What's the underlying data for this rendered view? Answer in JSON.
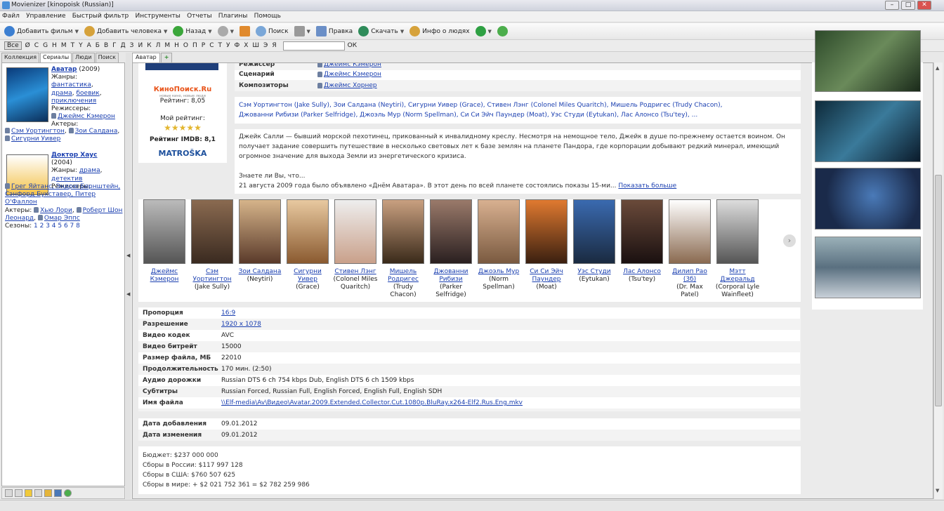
{
  "window": {
    "title": "Movienizer [kinopoisk (Russian)]"
  },
  "menu": [
    "Файл",
    "Управление",
    "Быстрый фильтр",
    "Инструменты",
    "Отчеты",
    "Плагины",
    "Помощь"
  ],
  "toolbar": {
    "add_movie": "Добавить фильм",
    "add_person": "Добавить человека",
    "back": "Назад",
    "search": "Поиск",
    "edit": "Правка",
    "download": "Скачать",
    "people_info": "Инфо о людях"
  },
  "alphabar": {
    "all": "Все",
    "letters": [
      "Ø",
      "C",
      "G",
      "H",
      "M",
      "T",
      "Y",
      "А",
      "Б",
      "В",
      "Г",
      "Д",
      "З",
      "И",
      "К",
      "Л",
      "М",
      "Н",
      "О",
      "П",
      "Р",
      "С",
      "Т",
      "У",
      "Ф",
      "Х",
      "Ш",
      "Э",
      "Я"
    ],
    "ok": "ОК"
  },
  "left_tabs": [
    "Коллекция",
    "Сериалы",
    "Люди",
    "Поиск"
  ],
  "left_movies": [
    {
      "title": "Аватар",
      "year": "(2009)",
      "genre_label": "Жанры:",
      "genres": [
        "фантастика",
        "драма",
        "боевик",
        "приключения"
      ],
      "director_label": "Режиссеры:",
      "director": "Джеймс Кэмерон",
      "actors_label": "Актеры:",
      "actors": [
        "Сэм Уортингтон",
        "Зои Салдана",
        "Сигурни Уивер"
      ]
    },
    {
      "title": "Доктор Хаус",
      "year": "(2004)",
      "genre_label": "Жанры:",
      "genres": [
        "драма",
        "детектив"
      ],
      "director_label": "Режиссеры:",
      "director": "Грег Яйтанс, Эндрю Бернштейн, Сэнфорд Букставер, Питер О'Фаллон",
      "actors_label": "Актеры:",
      "actors": [
        "Хью Лори",
        "Роберт Шон Леонард",
        "Омар Эппс"
      ],
      "seasons_label": "Сезоны:",
      "seasons": "1 2 3 4 5 6 7 8"
    }
  ],
  "right_tabs": [
    "Аватар",
    "+"
  ],
  "ratings": {
    "kp_logo": "КиноПоиск.Ru",
    "kp_sub": "новые кино, новые люди",
    "kp_rating": "Рейтинг: 8,05",
    "my_rating_label": "Мой рейтинг:",
    "stars": "★★★★★",
    "imdb": "Рейтинг IMDB: 8,1",
    "matroska": "MATROŠKA"
  },
  "credits": [
    {
      "label": "Режиссер",
      "value": "Джеймс Кэмерон"
    },
    {
      "label": "Сценарий",
      "value": "Джеймс Кэмерон"
    },
    {
      "label": "Композиторы",
      "value": "Джеймс Хорнер"
    }
  ],
  "cast_line1": "Сэм Уортингтон (Jake Sully), Зои Салдана (Neytiri), Сигурни Уивер (Grace), Стивен Лэнг (Colonel Miles Quaritch), Мишель Родригес (Trudy Chacon),",
  "cast_line2": "Джованни Рибизи (Parker Selfridge), Джоэль Мур (Norm Spellman), Си Си Эйч Паундер (Moat), Уэс Студи (Eytukan), Лас Алонсо (Tsu'tey), ...",
  "plot1": "Джейк Салли — бывший морской пехотинец, прикованный к инвалидному креслу. Несмотря на немощное тело, Джейк в душе по-прежнему остается воином. Он",
  "plot2": "получает задание совершить путешествие в несколько световых лет к базе землян на планете Пандора, где корпорации добывают редкий минерал, имеющий",
  "plot3": "огромное значение для выхода Земли из энергетического кризиса.",
  "trivia_label": "Знаете ли Вы, что...",
  "trivia": "21 августа 2009 года было объявлено «Днём Аватара». В этот день по всей планете состоялись показы 15-ми...",
  "trivia_more": "Показать больше",
  "persons": [
    {
      "name": "Джеймс Кэмерон",
      "role": ""
    },
    {
      "name": "Сэм Уортингтон",
      "role": "(Jake Sully)"
    },
    {
      "name": "Зои Салдана",
      "role": "(Neytiri)"
    },
    {
      "name": "Сигурни Уивер",
      "role": "(Grace)"
    },
    {
      "name": "Стивен Лэнг",
      "role": "(Colonel Miles Quaritch)"
    },
    {
      "name": "Мишель Родригес",
      "role": "(Trudy Chacon)"
    },
    {
      "name": "Джованни Рибизи",
      "role": "(Parker Selfridge)"
    },
    {
      "name": "Джоэль Мур",
      "role": "(Norm Spellman)"
    },
    {
      "name": "Си Си Эйч Паундер",
      "role": "(Moat)"
    },
    {
      "name": "Уэс Студи",
      "role": "(Eytukan)"
    },
    {
      "name": "Лас Алонсо",
      "role": "(Tsu'tey)"
    },
    {
      "name": "Дилип Рао (3б)",
      "role": "(Dr. Max Patel)"
    },
    {
      "name": "Мэтт Джеральд",
      "role": "(Corporal Lyle Wainfleet)"
    }
  ],
  "props": [
    {
      "k": "Пропорция",
      "v": "16:9",
      "link": true
    },
    {
      "k": "Разрешение",
      "v": "1920 x 1078",
      "link": true
    },
    {
      "k": "Видео кодек",
      "v": "AVC",
      "link": false
    },
    {
      "k": "Видео битрейт",
      "v": "15000",
      "link": false
    },
    {
      "k": "Размер файла, МБ",
      "v": "22010",
      "link": false
    },
    {
      "k": "Продолжительность",
      "v": "170 мин. (2:50)",
      "link": false
    },
    {
      "k": "Аудио дорожки",
      "v": "Russian DTS 6 ch 754 kbps Dub, English DTS 6 ch 1509 kbps",
      "link": false
    },
    {
      "k": "Субтитры",
      "v": "Russian Forced, Russian Full, English Forced, English Full, English SDH",
      "link": false
    },
    {
      "k": "Имя файла",
      "v": "\\\\Elf-media\\Av\\Видео\\Avatar.2009.Extended.Collector.Cut.1080p.BluRay.x264-Elf2.Rus.Eng.mkv",
      "link": true
    }
  ],
  "dates": [
    {
      "k": "Дата добавления",
      "v": "09.01.2012"
    },
    {
      "k": "Дата изменения",
      "v": "09.01.2012"
    }
  ],
  "finance": [
    "Бюджет: $237 000 000",
    "Сборы в России: $117 997 128",
    "Сборы в США: $760 507 625",
    "Сборы в мире: + $2 021 752 361 = $2 782 259 986"
  ]
}
